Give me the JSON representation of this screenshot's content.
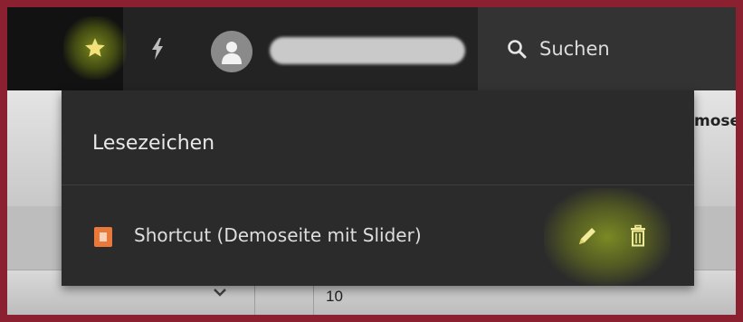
{
  "topbar": {
    "bookmark_icon": "star-icon",
    "live_search_icon": "lightning-bolt-icon",
    "avatar_icon": "user-avatar-icon",
    "search": {
      "icon": "search-icon",
      "label": "Suchen"
    }
  },
  "bookmarks": {
    "title": "Lesezeichen",
    "items": [
      {
        "icon": "page-icon",
        "label": "Shortcut (Demoseite mit Slider)",
        "edit_icon": "pencil-icon",
        "delete_icon": "trash-icon"
      }
    ]
  },
  "background_page": {
    "partial_heading": "mose",
    "row_value": "10"
  },
  "colors": {
    "frame_border": "#8a2030",
    "highlight": "#c8e22a",
    "star": "#f2e07a",
    "page_icon": "#e8793a"
  }
}
